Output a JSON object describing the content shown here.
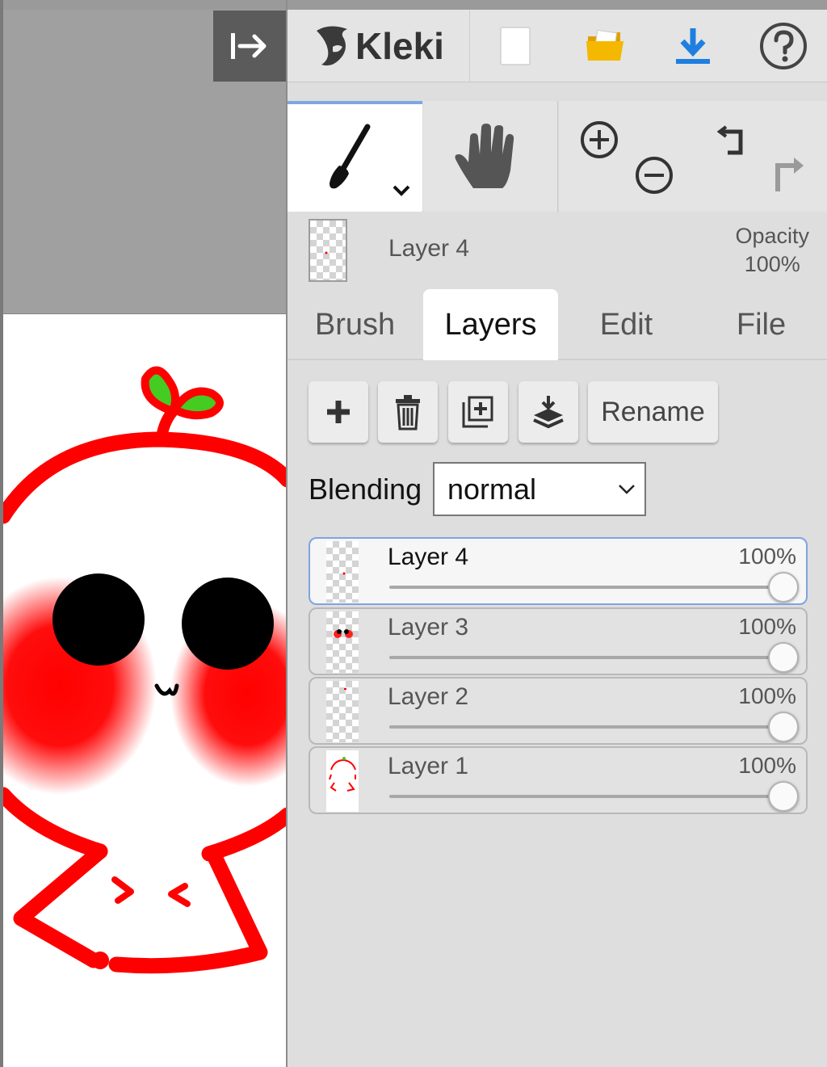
{
  "app": {
    "name": "Kleki"
  },
  "colors": {
    "accent": "#7fa6e3",
    "download": "#1e7fe0",
    "folder": "#f5b800",
    "art_red": "#ff0000",
    "art_leaf": "#44cc22"
  },
  "top_bar": {
    "icons": [
      "collapse-panel-icon",
      "new-file-icon",
      "open-folder-icon",
      "download-icon",
      "help-icon"
    ]
  },
  "tools": {
    "brush": "brush-icon",
    "hand": "hand-icon",
    "zoom_in": "zoom-in-icon",
    "zoom_out": "zoom-out-icon",
    "undo": "undo-icon",
    "redo": "redo-icon"
  },
  "current_layer": {
    "name": "Layer 4",
    "opacity_label": "Opacity",
    "opacity_value": "100%"
  },
  "tabs": [
    {
      "label": "Brush",
      "active": false
    },
    {
      "label": "Layers",
      "active": true
    },
    {
      "label": "Edit",
      "active": false
    },
    {
      "label": "File",
      "active": false
    }
  ],
  "layer_actions": {
    "icons": [
      "add-layer-icon",
      "delete-layer-icon",
      "duplicate-layer-icon",
      "merge-down-icon"
    ],
    "rename_label": "Rename"
  },
  "blending": {
    "label": "Blending",
    "value": "normal"
  },
  "layers": [
    {
      "name": "Layer 4",
      "opacity": "100%",
      "opacity_level": 1.0,
      "selected": true
    },
    {
      "name": "Layer 3",
      "opacity": "100%",
      "opacity_level": 1.0,
      "selected": false
    },
    {
      "name": "Layer 2",
      "opacity": "100%",
      "opacity_level": 1.0,
      "selected": false
    },
    {
      "name": "Layer 1",
      "opacity": "100%",
      "opacity_level": 1.0,
      "selected": false
    }
  ]
}
